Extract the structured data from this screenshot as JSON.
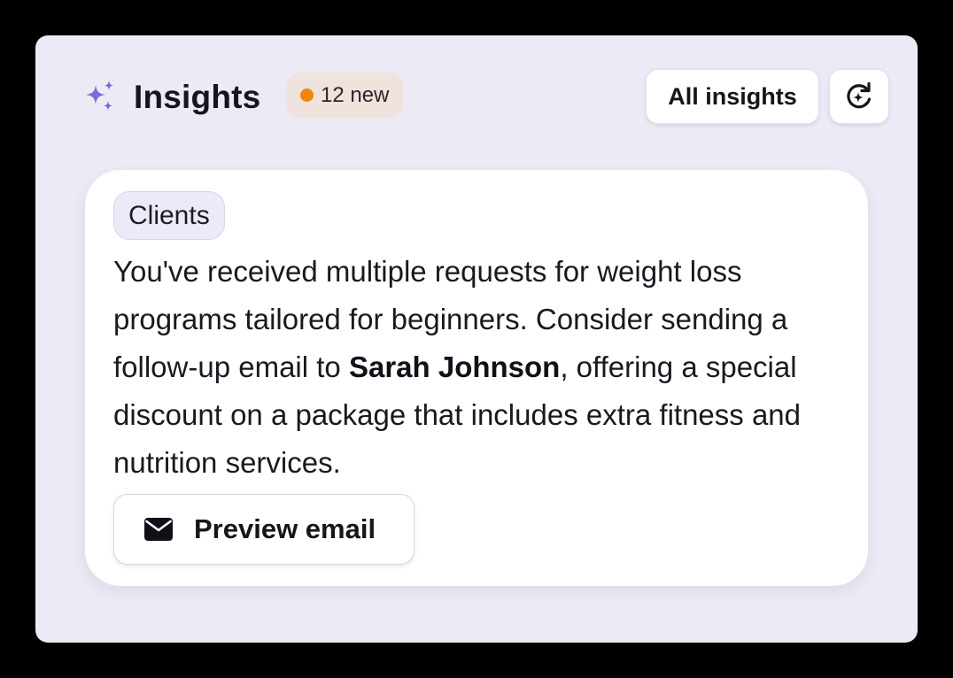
{
  "header": {
    "icon": "sparkle-icon",
    "title": "Insights",
    "badge": {
      "text": "12 new",
      "dot_color": "#F0870D"
    },
    "all_insights_label": "All insights",
    "refresh_icon": "refresh-sparkle-icon"
  },
  "insight_card": {
    "tag": "Clients",
    "text_before": "You've received multiple requests for weight loss programs tailored for beginners. Consider sending a follow-up email to ",
    "client_name": "Sarah Johnson",
    "text_after": ", offering a special discount on a package that includes extra fitness and nutrition services.",
    "action": {
      "icon": "mail-icon",
      "label": "Preview email"
    }
  },
  "colors": {
    "panel_background": "#ECEAF4",
    "accent_sparkle": "#7A6BD8",
    "badge_background": "#F0E2DC"
  }
}
